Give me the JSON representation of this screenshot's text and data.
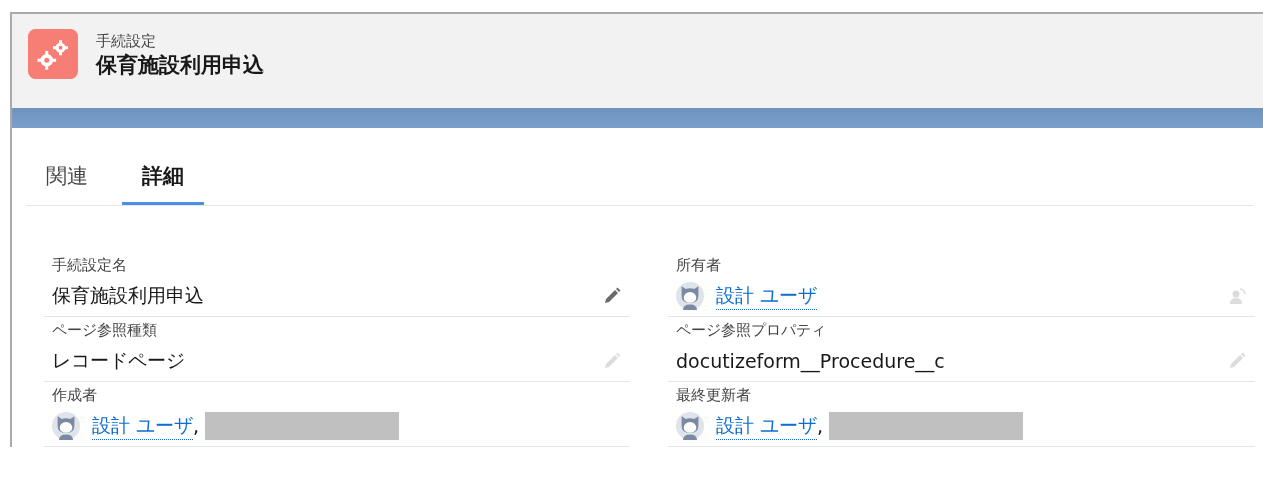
{
  "header": {
    "object_type": "手続設定",
    "title": "保育施設利用申込"
  },
  "tabs": [
    {
      "label": "関連",
      "selected": false
    },
    {
      "label": "詳細",
      "selected": true
    }
  ],
  "fields": [
    {
      "label": "手続設定名",
      "kind": "text",
      "value": "保育施設利用申込",
      "action": {
        "kind": "edit",
        "disabled": false
      }
    },
    {
      "label": "所有者",
      "kind": "user",
      "value": "設計 ユーザ",
      "action": {
        "kind": "change-owner",
        "disabled": true
      }
    },
    {
      "label": "ページ参照種類",
      "kind": "text",
      "value": "レコードページ",
      "action": {
        "kind": "edit",
        "disabled": true
      }
    },
    {
      "label": "ページ参照プロパティ",
      "kind": "text",
      "value": "docutizeform__Procedure__c",
      "action": {
        "kind": "edit",
        "disabled": true
      }
    },
    {
      "label": "作成者",
      "kind": "user",
      "value": "設計 ユーザ",
      "separator": ",",
      "redacted": true
    },
    {
      "label": "最終更新者",
      "kind": "user",
      "value": "設計 ユーザ",
      "separator": ",",
      "redacted": true
    }
  ]
}
